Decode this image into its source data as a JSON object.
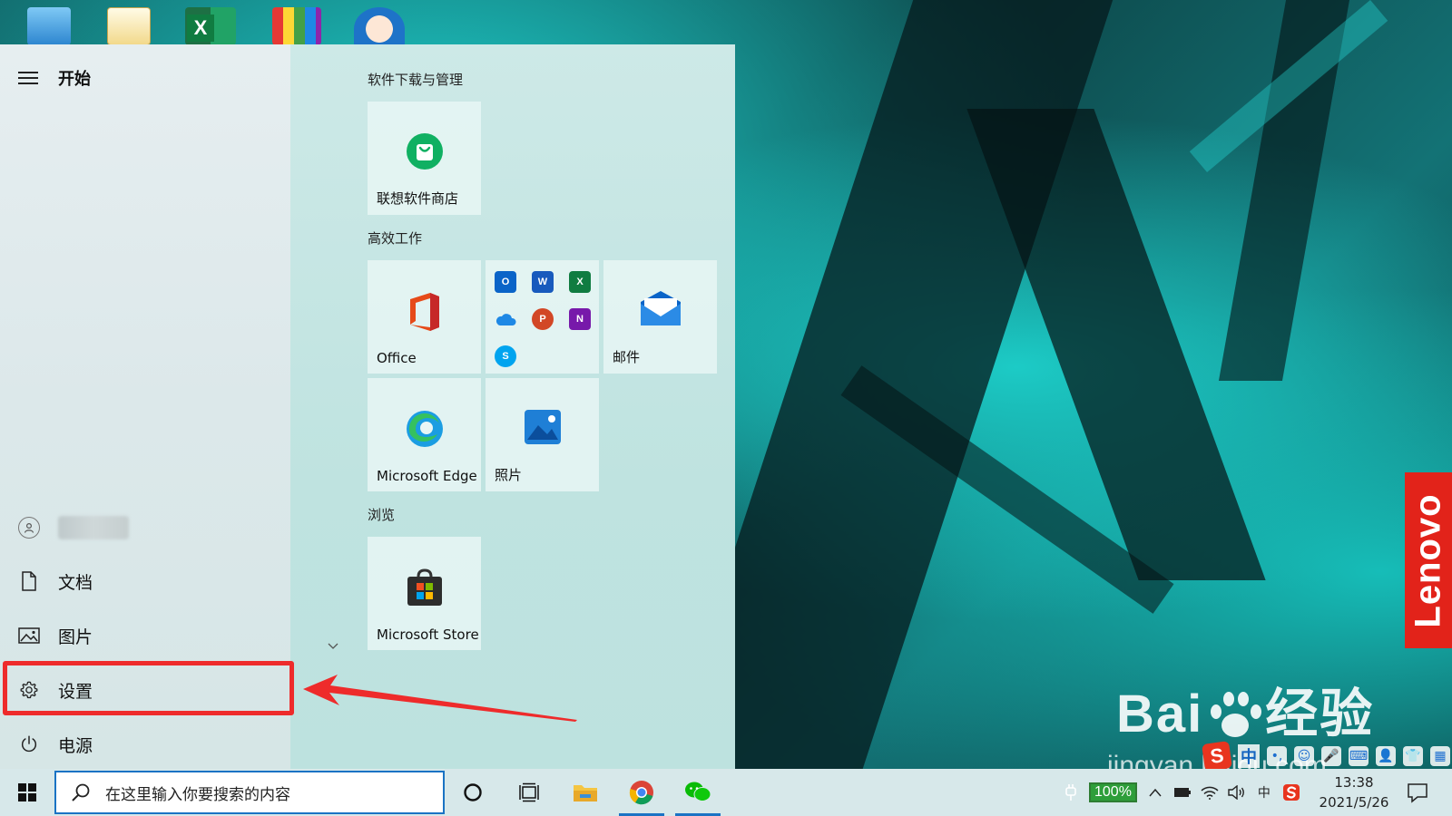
{
  "start_menu": {
    "title": "开始",
    "nav": {
      "documents": "文档",
      "pictures": "图片",
      "settings": "设置",
      "power": "电源"
    },
    "groups": [
      {
        "title": "软件下载与管理"
      },
      {
        "title": "高效工作"
      },
      {
        "title": "浏览"
      }
    ],
    "tiles": {
      "lenovo_store": "联想软件商店",
      "office": "Office",
      "mail": "邮件",
      "edge": "Microsoft Edge",
      "photos": "照片",
      "store": "Microsoft Store"
    }
  },
  "taskbar": {
    "search_placeholder": "在这里输入你要搜索的内容",
    "battery": "100%",
    "ime": "中",
    "time": "13:38",
    "date": "2021/5/26"
  },
  "desktop": {
    "lenovo_badge": "Lenovo",
    "watermark_logo_left": "Bai",
    "watermark_logo_right": "经验",
    "watermark_url": "jingyan.baidu.com",
    "ime_bar_label": "中"
  },
  "colors": {
    "highlight": "#ee2b2b",
    "accent": "#1a73c4",
    "lenovo": "#e2231a"
  }
}
